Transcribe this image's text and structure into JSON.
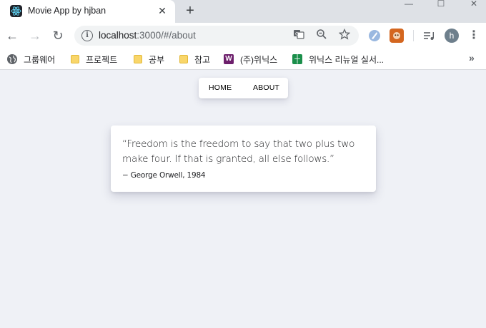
{
  "browser": {
    "tab": {
      "title": "Movie App by hjban",
      "close_glyph": "✕",
      "favicon": "react-logo-icon"
    },
    "new_tab_glyph": "+",
    "window_controls": {
      "minimize": "—",
      "maximize": "☐",
      "close": "✕"
    },
    "toolbar": {
      "back_glyph": "←",
      "forward_glyph": "→",
      "reload_glyph": "↻",
      "url_host": "localhost",
      "url_rest": ":3000/#/about",
      "menu_glyph": "⋮",
      "avatar_letter": "h"
    },
    "bookmarks": [
      {
        "label": "그룹웨어",
        "icon": "globe-icon"
      },
      {
        "label": "프로젝트",
        "icon": "folder-icon"
      },
      {
        "label": "공부",
        "icon": "folder-icon"
      },
      {
        "label": "참고",
        "icon": "folder-icon"
      },
      {
        "label": "(주)위닉스",
        "icon": "winix-logo-icon"
      },
      {
        "label": "위닉스 리뉴얼 실서...",
        "icon": "sheets-icon"
      }
    ],
    "bookmarks_more": "»"
  },
  "page": {
    "nav": {
      "home": "HOME",
      "about": "ABOUT"
    },
    "quote": {
      "text": "“Freedom is the freedom to say that two plus two make four. If that is granted, all else follows.”",
      "author": "− George Orwell, 1984"
    }
  },
  "colors": {
    "page_background": "#eff1f6",
    "tabstrip": "#dee1e6",
    "card": "#ffffff",
    "text": "#202124"
  }
}
